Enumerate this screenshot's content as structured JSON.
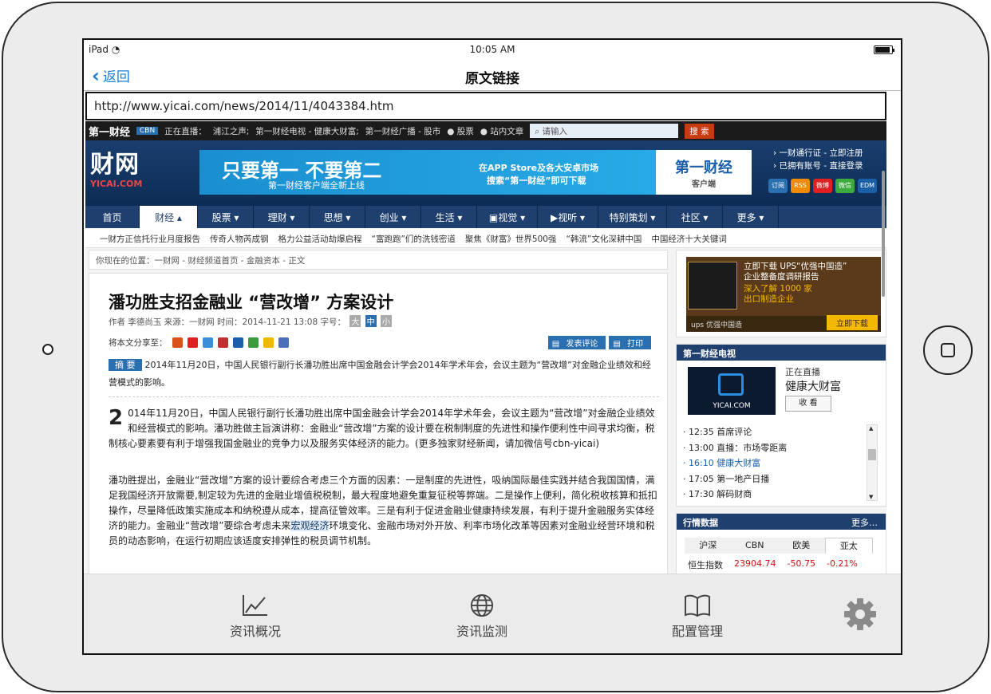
{
  "status_bar": {
    "device": "iPad",
    "time": "10:05 AM"
  },
  "nav": {
    "back_label": "返回",
    "title": "原文链接"
  },
  "url": "http://www.yicai.com/news/2014/11/4043384.htm",
  "site": {
    "top_logo": "第一财经",
    "top_cbn": "CBN",
    "live_text": "正在直播：",
    "live_items": [
      "浦江之声;",
      "第一财经电视 - 健康大财富;",
      "第一财经广播 - 股市"
    ],
    "radio_stock": "股票",
    "radio_site": "站内文章",
    "search_placeholder": "请输入",
    "search_button": "搜 索",
    "logo_big": "财网",
    "logo_small": "YICAI.COM",
    "banner_main": "只要第一  不要第二",
    "banner_sub": "第一财经客户端全新上线",
    "banner_store1": "在APP Store及各大安卓市场",
    "banner_store2": "搜索“第一财经”即可下载",
    "banner_brand": "第一财经",
    "banner_brand_sub": "客户端",
    "header_links": [
      "一财通行证 - 立即注册",
      "已拥有账号 - 直接登录"
    ],
    "social": [
      "订阅",
      "RSS",
      "微博",
      "微信",
      "EDM"
    ],
    "main_nav": [
      "首页",
      "财经",
      "股票",
      "理财",
      "思想",
      "创业",
      "生活",
      "视觉",
      "视听",
      "特别策划",
      "社区",
      "更多"
    ],
    "active_nav": "财经",
    "sub_nav": [
      "一财方正信托行业月度报告",
      "传奇人物芮成钢",
      "格力公益活动劫爆启程",
      "“富跑跑”们的洗钱密道",
      "聚焦《财富》世界500强",
      "“韩流”文化深耕中国",
      "中国经济十大关键词"
    ],
    "breadcrumb": "你现在的位置：一财网 - 财经频道首页 - 金融资本 - 正文"
  },
  "article": {
    "title": "潘功胜支招金融业 “营改增” 方案设计",
    "meta": "作者 李德尚玉    来源：一财网    时间：2014-11-21 13:08    字号：",
    "size_options": [
      "大",
      "中",
      "小"
    ],
    "share_label": "将本文分享至：",
    "comment_btn": "发表评论",
    "print_btn": "打印",
    "abstract_tag": "摘 要",
    "abstract": "2014年11月20日，中国人民银行副行长潘功胜出席中国金融会计学会2014年学术年会，会议主题为“营改增”对金融企业绩效和经营模式的影响。",
    "dropcap": "2",
    "para1": "014年11月20日，中国人民银行副行长潘功胜出席中国金融会计学会2014年学术年会，会议主题为“营改增”对金融企业绩效和经营模式的影响。潘功胜做主旨演讲称：金融业“营改增”方案的设计要在税制制度的先进性和操作便利性中间寻求均衡，税制核心要素要有利于增强我国金融业的竞争力以及服务实体经济的能力。(更多独家财经新闻，请加微信号cbn-yicai)",
    "para2_a": "潘功胜提出，金融业“营改增”方案的设计要综合考虑三个方面的因素：一是制度的先进性，吸纳国际最佳实践并结合我国国情，满足我国经济开放需要,制定较为先进的金融业增值税税制，最大程度地避免重复征税等弊端。二是操作上便利，简化税收核算和抵扣操作，尽量降低政策实施成本和纳税遵从成本，提高征管效率。三是有利于促进金融业健康持续发展，有利于提升金融服务实体经济的能力。金融业“营改增”要综合考虑未来",
    "para2_hl": "宏观经济",
    "para2_b": "环境变化、金融市场对外开放、利率市场化改革等因素对金融业经营环境和税员的动态影响，在运行初期应该适度安排弹性的税员调节机制。"
  },
  "sidebar": {
    "ad_text1": "立即下载 UPS“优强中国造”",
    "ad_text2": "企业整备度调研报告",
    "ad_text3": "深入了解 1000 家",
    "ad_text4": "出口制造企业",
    "ad_strip": "优强中国造",
    "ad_button": "立即下载",
    "tv_header": "第一财经电视",
    "tv_thumb_label": "YICAI.COM",
    "tv_live": "正在直播",
    "tv_program": "健康大财富",
    "tv_watch": "收 看",
    "schedule": [
      {
        "time": "12:35",
        "name": "首席评论"
      },
      {
        "time": "13:00",
        "name": "直播：市场零距离"
      },
      {
        "time": "16:10",
        "name": "健康大财富"
      },
      {
        "time": "17:05",
        "name": "第一地产日播"
      },
      {
        "time": "17:30",
        "name": "解码财商"
      }
    ],
    "current_index": 2,
    "market_header": "行情数据",
    "market_more": "更多",
    "market_tabs": [
      "沪深",
      "CBN",
      "欧美",
      "亚太"
    ],
    "market_active": "亚太",
    "market_row": {
      "name": "恒生指数",
      "value": "23904.74",
      "change": "-50.75",
      "pct": "-0.21%"
    }
  },
  "tabbar": [
    {
      "label": "资讯概况",
      "icon": "chart-line-icon"
    },
    {
      "label": "资讯监测",
      "icon": "globe-icon"
    },
    {
      "label": "配置管理",
      "icon": "book-icon"
    },
    {
      "label": "",
      "icon": "gear-icon"
    }
  ],
  "colors": {
    "accent": "#1a7dd6",
    "site_navy": "#1f3f6e",
    "down_red": "#d01010"
  }
}
